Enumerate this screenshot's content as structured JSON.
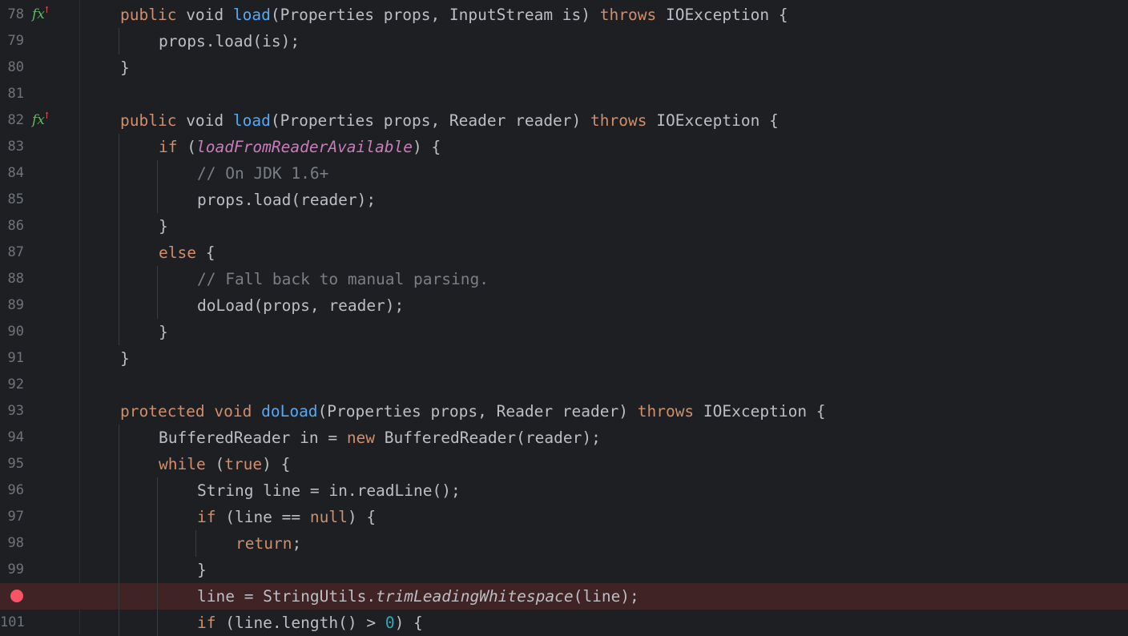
{
  "editor": {
    "breakpoint_color": "#f75464",
    "lines": [
      {
        "num": "78",
        "icon": "fx-override-icon",
        "indent": 1,
        "tokens": [
          [
            "kw",
            "public"
          ],
          [
            "",
            "void"
          ],
          [
            "",
            ""
          ],
          [
            "fn",
            "load"
          ],
          [
            "",
            "(Properties props, InputStream is) "
          ],
          [
            "kw",
            "throws"
          ],
          [
            "",
            " IOException {"
          ]
        ]
      },
      {
        "num": "79",
        "indent": 2,
        "tokens": [
          [
            "",
            "props.load(is);"
          ]
        ]
      },
      {
        "num": "80",
        "indent": 1,
        "tokens": [
          [
            "",
            "}"
          ]
        ]
      },
      {
        "num": "81",
        "indent": 0,
        "tokens": []
      },
      {
        "num": "82",
        "icon": "fx-override-icon",
        "indent": 1,
        "tokens": [
          [
            "kw",
            "public"
          ],
          [
            "",
            "void"
          ],
          [
            "",
            ""
          ],
          [
            "fn",
            "load"
          ],
          [
            "",
            "(Properties props, Reader reader) "
          ],
          [
            "kw",
            "throws"
          ],
          [
            "",
            " IOException {"
          ]
        ]
      },
      {
        "num": "83",
        "indent": 2,
        "tokens": [
          [
            "kw",
            "if"
          ],
          [
            "",
            " ("
          ],
          [
            "fld",
            "loadFromReaderAvailable"
          ],
          [
            "",
            ") {"
          ]
        ]
      },
      {
        "num": "84",
        "indent": 3,
        "tokens": [
          [
            "cm",
            "// On JDK 1.6+"
          ]
        ]
      },
      {
        "num": "85",
        "indent": 3,
        "tokens": [
          [
            "",
            "props.load(reader);"
          ]
        ]
      },
      {
        "num": "86",
        "indent": 2,
        "tokens": [
          [
            "",
            "}"
          ]
        ]
      },
      {
        "num": "87",
        "indent": 2,
        "tokens": [
          [
            "kw",
            "else"
          ],
          [
            "",
            " {"
          ]
        ]
      },
      {
        "num": "88",
        "indent": 3,
        "tokens": [
          [
            "cm",
            "// Fall back to manual parsing."
          ]
        ]
      },
      {
        "num": "89",
        "indent": 3,
        "tokens": [
          [
            "",
            "doLoad(props, reader);"
          ]
        ]
      },
      {
        "num": "90",
        "indent": 2,
        "tokens": [
          [
            "",
            "}"
          ]
        ]
      },
      {
        "num": "91",
        "indent": 1,
        "tokens": [
          [
            "",
            "}"
          ]
        ]
      },
      {
        "num": "92",
        "indent": 0,
        "tokens": []
      },
      {
        "num": "93",
        "indent": 1,
        "tokens": [
          [
            "kw",
            "protected"
          ],
          [
            "kw",
            "void"
          ],
          [
            "",
            ""
          ],
          [
            "fn",
            "doLoad"
          ],
          [
            "",
            "(Properties props, Reader reader) "
          ],
          [
            "kw",
            "throws"
          ],
          [
            "",
            " IOException {"
          ]
        ]
      },
      {
        "num": "94",
        "indent": 2,
        "tokens": [
          [
            "",
            "BufferedReader in = "
          ],
          [
            "kw",
            "new"
          ],
          [
            "",
            " BufferedReader(reader);"
          ]
        ]
      },
      {
        "num": "95",
        "indent": 2,
        "tokens": [
          [
            "kw",
            "while"
          ],
          [
            "",
            " ("
          ],
          [
            "kw",
            "true"
          ],
          [
            "",
            ") {"
          ]
        ]
      },
      {
        "num": "96",
        "indent": 3,
        "tokens": [
          [
            "",
            "String line = in.readLine();"
          ]
        ]
      },
      {
        "num": "97",
        "indent": 3,
        "tokens": [
          [
            "kw",
            "if"
          ],
          [
            "",
            " (line == "
          ],
          [
            "kw",
            "null"
          ],
          [
            "",
            ") {"
          ]
        ]
      },
      {
        "num": "98",
        "indent": 4,
        "tokens": [
          [
            "kw",
            "return"
          ],
          [
            "",
            ";"
          ]
        ]
      },
      {
        "num": "99",
        "indent": 3,
        "tokens": [
          [
            "",
            "}"
          ]
        ]
      },
      {
        "num": "",
        "breakpoint": true,
        "indent": 3,
        "tokens": [
          [
            "",
            "line = StringUtils."
          ],
          [
            "it",
            "trimLeadingWhitespace"
          ],
          [
            "",
            "(line);"
          ]
        ]
      },
      {
        "num": "101",
        "indent": 3,
        "tokens": [
          [
            "kw",
            "if"
          ],
          [
            "",
            " (line.length() > "
          ],
          [
            "num",
            "0"
          ],
          [
            "",
            ") {"
          ]
        ]
      }
    ]
  }
}
